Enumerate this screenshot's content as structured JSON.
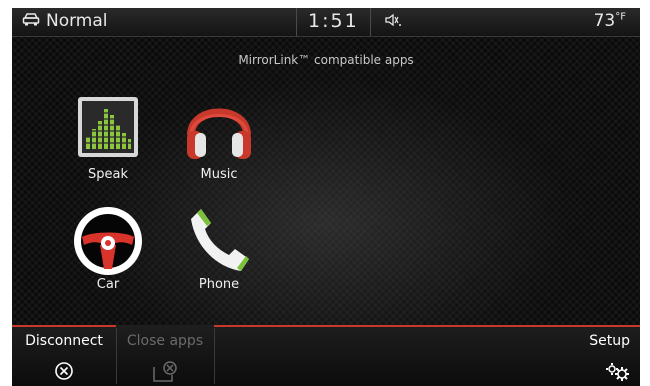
{
  "status_bar": {
    "mode_label": "Normal",
    "mode_icon": "car-icon",
    "time": "1:51",
    "volume_icon": "speaker-icon",
    "temperature": "73",
    "temperature_unit": "°F"
  },
  "main": {
    "subtitle": "MirrorLink™ compatible apps",
    "apps": [
      {
        "label": "Speak",
        "icon": "speak-equalizer-icon"
      },
      {
        "label": "Music",
        "icon": "headphones-icon"
      },
      {
        "label": "Car",
        "icon": "steering-wheel-icon"
      },
      {
        "label": "Phone",
        "icon": "phone-handset-icon"
      }
    ]
  },
  "bottom_bar": {
    "disconnect_label": "Disconnect",
    "close_apps_label": "Close apps",
    "setup_label": "Setup"
  },
  "colors": {
    "accent_red": "#c8392b",
    "phone_green": "#7cc13a",
    "speak_green": "#8cc63f"
  }
}
